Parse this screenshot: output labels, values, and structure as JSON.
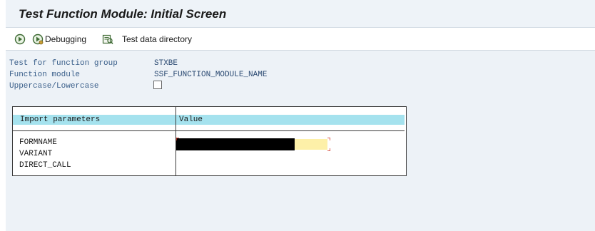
{
  "window": {
    "title": "Test Function Module: Initial Screen"
  },
  "toolbar": {
    "execute_icon": "execute-icon",
    "debugging_label": "Debugging",
    "debugging_icon": "debug-icon",
    "test_data_directory_label": "Test data directory",
    "test_data_directory_icon": "test-data-directory-icon"
  },
  "form": {
    "function_group_label": "Test for function group",
    "function_group_value": "STXBE",
    "function_module_label": "Function module",
    "function_module_value": "SSF_FUNCTION_MODULE_NAME",
    "case_label": "Uppercase/Lowercase",
    "case_checked": false
  },
  "import_parameters": {
    "header_parameter": "Import parameters",
    "header_value": "Value",
    "rows": [
      {
        "name": "FORMNAME"
      },
      {
        "name": "VARIANT"
      },
      {
        "name": "DIRECT_CALL"
      }
    ]
  },
  "colors": {
    "header_bg": "#a5e2ee",
    "input_highlight": "#fdf0a8",
    "label_color": "#3a5f8a",
    "content_bg": "#edf2f7"
  }
}
